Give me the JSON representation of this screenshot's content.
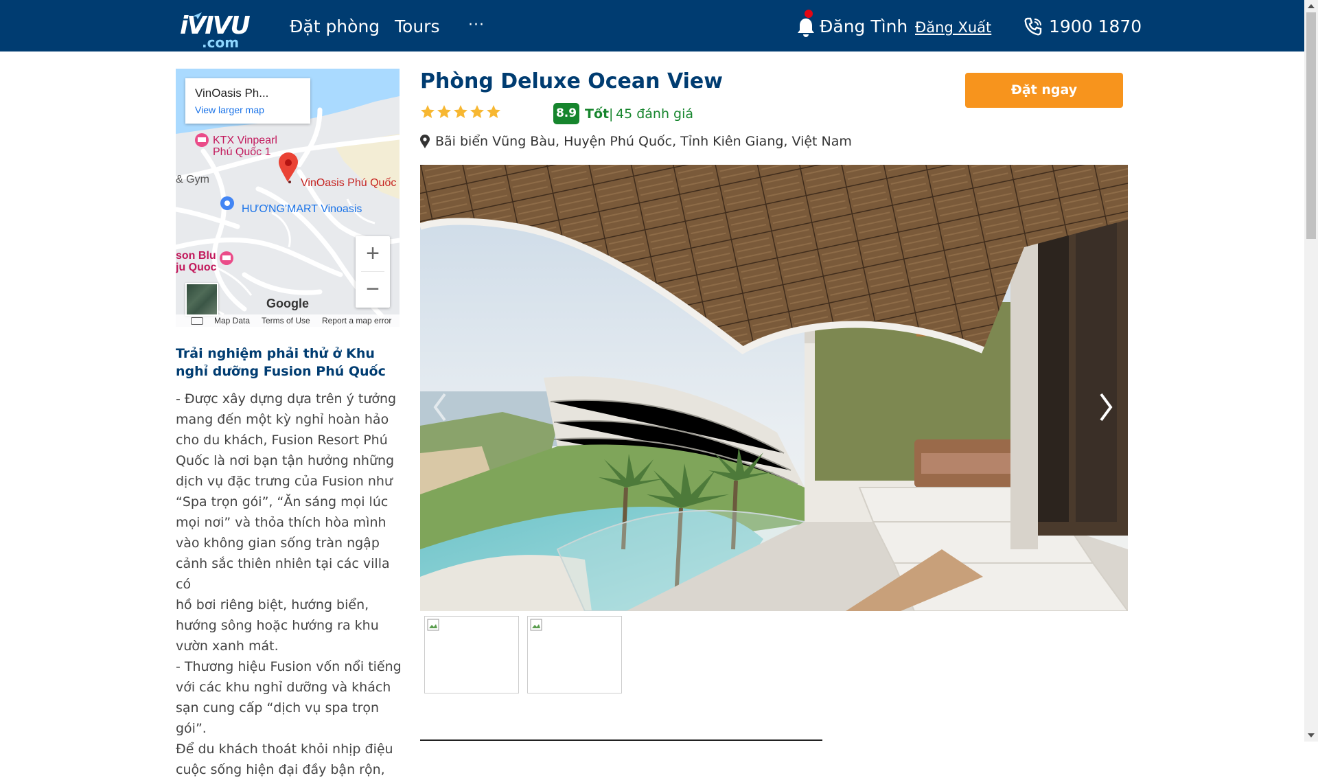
{
  "header": {
    "logo_main": "iVIVU",
    "logo_sub": ".com",
    "nav": [
      "Đặt phòng",
      "Tours"
    ],
    "more": "···",
    "user_name": "Đăng Tình",
    "logout": "Đăng Xuất",
    "phone": "1900 1870",
    "colors": {
      "bar": "#003c71",
      "notification_dot": "#e30613"
    }
  },
  "map": {
    "place_title": "VinOasis Ph...",
    "larger_map_link": "View larger map",
    "labels": {
      "ktx_line1": "KTX Vinpearl",
      "ktx_line2": "Phú Quốc 1",
      "gym": "& Gym",
      "hotel": "VinOasis Phú Quốc",
      "mart": "HƯƠNG'MART Vinoasis",
      "sonblu_line1": "son Blu",
      "sonblu_line2": "ju Quoc"
    },
    "zoom_in": "+",
    "zoom_out": "−",
    "google": "Google",
    "footer": {
      "data": "Map Data",
      "terms": "Terms of Use",
      "report": "Report a map error"
    }
  },
  "experience": {
    "title": "Trải nghiệm phải thử ở Khu nghỉ dưỡng Fusion Phú Quốc",
    "body": "- Được xây dựng dựa trên ý tưởng\nmang đến một kỳ nghỉ hoàn hảo\ncho du khách, Fusion Resort Phú\nQuốc là nơi bạn tận hưởng những\ndịch vụ đặc trưng của Fusion như\n“Spa trọn gói”, “Ăn sáng mọi lúc\nmọi nơi” và thỏa thích hòa mình\nvào không gian sống tràn ngập\ncảnh sắc thiên nhiên tại các villa có\nhồ bơi riêng biệt, hướng biển,\nhướng sông hoặc hướng ra khu\nvườn xanh mát.\n- Thương hiệu Fusion vốn nổi tiếng\nvới các khu nghỉ dưỡng và khách\nsạn cung cấp “dịch vụ spa trọn gói”.\nĐể du khách thoát khỏi nhịp điệu\ncuộc sống hiện đại đầy bận rộn,"
  },
  "room": {
    "title": "Phòng Deluxe Ocean View",
    "stars": 5,
    "score": "8.9",
    "score_label": "Tốt",
    "separator": "|",
    "reviews": "45 đánh giá",
    "address": "Bãi biển Vũng Bàu, Huyện Phú Quốc, Tỉnh Kiên Giang, Việt Nam",
    "book_button": "Đặt ngay",
    "colors": {
      "title": "#003c71",
      "score_bg": "#16852d",
      "book_bg": "#f7941d",
      "stars": "#f7b731"
    }
  }
}
